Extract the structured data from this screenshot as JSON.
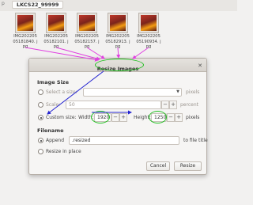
{
  "file_manager": {
    "tab_fragment": "p",
    "folder_path": "LKCS22_99999",
    "files": [
      {
        "name": "IMG202205 05181840. jpg"
      },
      {
        "name": "IMG202205 05182101. jpg"
      },
      {
        "name": "IMG202205 05182157. jpg"
      },
      {
        "name": "IMG202205 05182913. jpg"
      },
      {
        "name": "IMG202205 05190934. jpg"
      }
    ]
  },
  "dialog": {
    "title": "Resize Images",
    "close_icon": "close-icon",
    "image_size": {
      "heading": "Image Size",
      "select_size_label": "Select a size:",
      "select_size_value": "",
      "select_size_unit": "pixels",
      "scale_label": "Scale:",
      "scale_value": "50",
      "scale_unit": "percent",
      "custom_size_label": "Custom size:",
      "width_label": "Width:",
      "width_value": "1920",
      "height_label": "Height:",
      "height_value": "1250",
      "custom_unit": "pixels",
      "selected_option": "custom"
    },
    "filename": {
      "heading": "Filename",
      "append_label": "Append",
      "append_value": ".resized",
      "append_suffix": "to file title",
      "resize_in_place_label": "Resize in place",
      "selected_option": "append"
    },
    "buttons": {
      "cancel": "Cancel",
      "resize": "Resize"
    }
  },
  "colors": {
    "annotation_arrows": "#e040e0",
    "annotation_blue": "#2424d0",
    "annotation_green": "#22c022"
  }
}
